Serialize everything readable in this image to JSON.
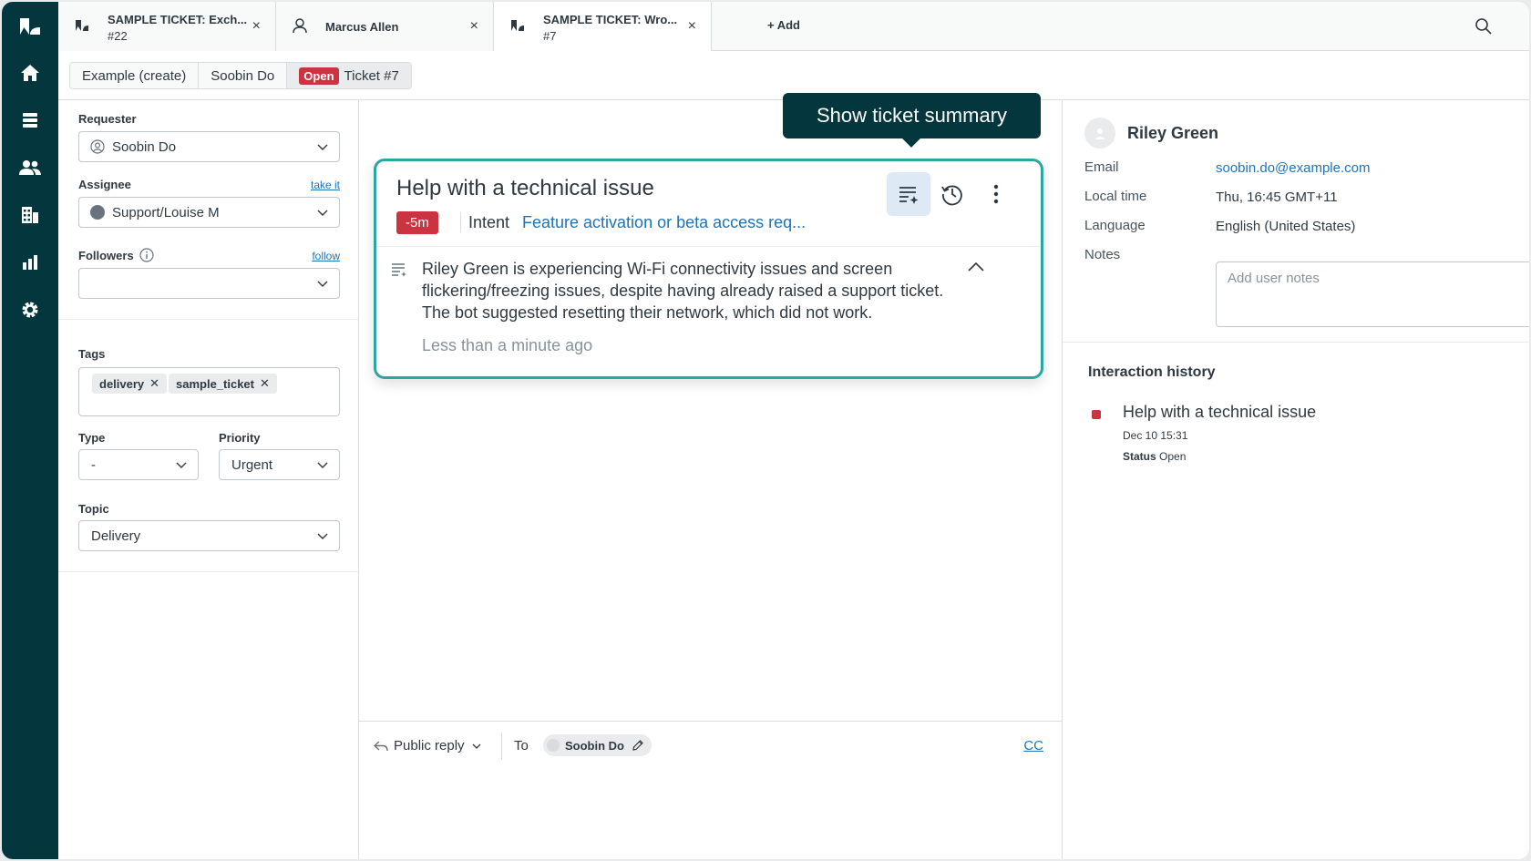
{
  "tabs": [
    {
      "title": "SAMPLE TICKET: Exch...",
      "sub": "#22",
      "close": "×"
    },
    {
      "title": "Marcus Allen",
      "close": "×"
    },
    {
      "title": "SAMPLE TICKET: Wro...",
      "sub": "#7",
      "close": "×"
    }
  ],
  "add_tab_label": "+ Add",
  "breadcrumbs": {
    "item1": "Example (create)",
    "item2": "Soobin Do",
    "status_badge": "Open",
    "item3": "Ticket #7"
  },
  "properties": {
    "requester_label": "Requester",
    "requester_value": "Soobin Do",
    "assignee_label": "Assignee",
    "take_it": "take it",
    "assignee_value": "Support/Louise M",
    "followers_label": "Followers",
    "follow": "follow",
    "tags_label": "Tags",
    "tags": [
      "delivery",
      "sample_ticket"
    ],
    "type_label": "Type",
    "type_value": "-",
    "priority_label": "Priority",
    "priority_value": "Urgent",
    "topic_label": "Topic",
    "topic_value": "Delivery"
  },
  "tooltip": "Show ticket summary",
  "card": {
    "title": "Help with a technical issue",
    "sla": "-5m",
    "intent_label": "Intent",
    "intent_value": "Feature activation or beta access req...",
    "summary": "Riley Green is experiencing Wi-Fi connectivity issues and screen flickering/freezing issues, despite having already raised a support ticket. The bot suggested resetting their network, which did not work.",
    "time": "Less than a minute ago"
  },
  "composer": {
    "reply_type": "Public reply",
    "to_label": "To",
    "to_value": "Soobin Do",
    "cc": "CC"
  },
  "user": {
    "name": "Riley Green",
    "email_label": "Email",
    "email": "soobin.do@example.com",
    "local_time_label": "Local time",
    "local_time": "Thu, 16:45 GMT+11",
    "language_label": "Language",
    "language": "English (United States)",
    "notes_label": "Notes",
    "notes_placeholder": "Add user notes"
  },
  "interaction_history": {
    "title": "Interaction history",
    "items": [
      {
        "title": "Help with a technical issue",
        "date": "Dec 10 15:31",
        "status_label": "Status",
        "status": "Open"
      }
    ]
  },
  "colors": {
    "nav_bg": "#03363d",
    "accent_teal": "#2aa7a0",
    "alert_red": "#cc3340",
    "link_blue": "#1f73b7"
  },
  "icons": [
    "zendesk-logo-icon",
    "home-icon",
    "views-icon",
    "customers-icon",
    "organizations-icon",
    "reporting-icon",
    "admin-gear-icon",
    "search-icon",
    "summary-icon",
    "history-icon",
    "more-icon",
    "chevron-up-icon",
    "reply-arrow-icon",
    "pencil-icon"
  ]
}
